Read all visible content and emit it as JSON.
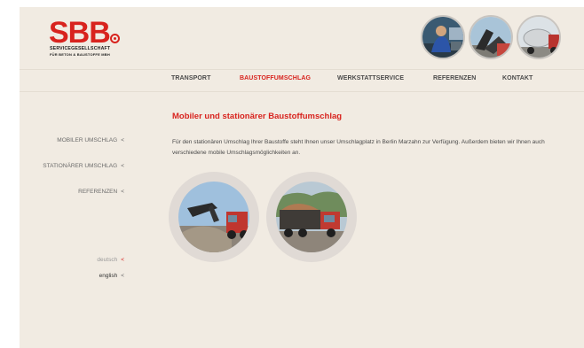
{
  "logo": {
    "text": "SBB",
    "line1": "SERVICEGESELLSCHAFT",
    "line2": "FÜR BETON & BAUSTOFFE MBH",
    "color": "#d8231e"
  },
  "nav": {
    "items": [
      {
        "label": "TRANSPORT"
      },
      {
        "label": "BAUSTOFFUMSCHLAG"
      },
      {
        "label": "WERKSTATTSERVICE"
      },
      {
        "label": "REFERENZEN"
      },
      {
        "label": "KONTAKT"
      }
    ],
    "active": "BAUSTOFFUMSCHLAG"
  },
  "sidebar": {
    "items": [
      {
        "label": "MOBILER UMSCHLAG",
        "arrow": "<"
      },
      {
        "label": "STATIONÄRER UMSCHLAG",
        "arrow": "<"
      },
      {
        "label": "REFERENZEN",
        "arrow": "<"
      }
    ]
  },
  "languages": {
    "items": [
      {
        "label": "deutsch",
        "arrow": "<"
      },
      {
        "label": "english",
        "arrow": "<"
      }
    ]
  },
  "main": {
    "headline": "Mobiler und stationärer Baustoffumschlag",
    "body": "Für den stationären Umschlag Ihrer Baustoffe steht Ihnen unser Umschlagplatz in Berlin Marzahn zur Verfügung. Außerdem bieten wir Ihnen auch verschiedene mobile Umschlagsmöglichkeiten an."
  },
  "colors": {
    "accent": "#d8231e",
    "page_background": "#f1ebe2",
    "text": "#4a4a4a"
  },
  "images": {
    "header_photos": [
      "mechanic-icon",
      "excavator-icon",
      "mixer-truck-icon"
    ],
    "content_photos": [
      "excavator-loading-truck-icon",
      "truck-bulk-goods-icon"
    ]
  }
}
